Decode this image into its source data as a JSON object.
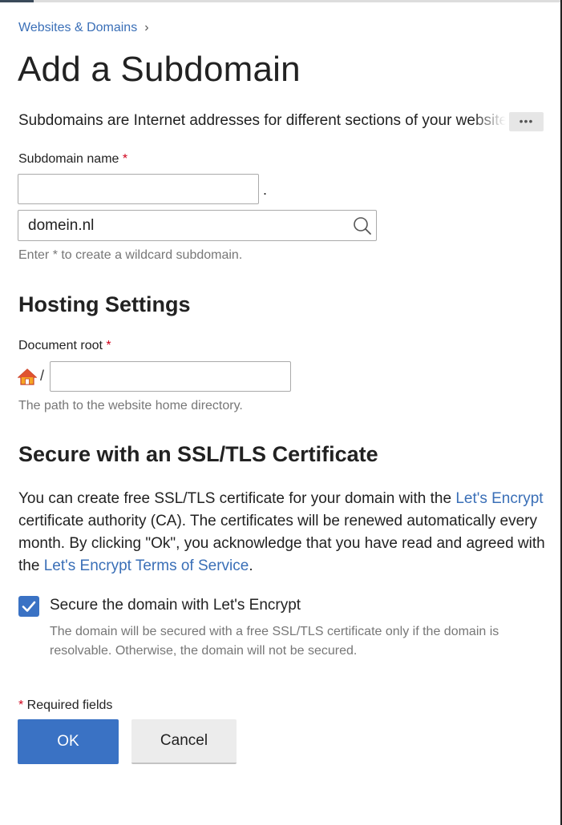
{
  "breadcrumb": {
    "link": "Websites & Domains",
    "chevron": "›"
  },
  "page_title": "Add a Subdomain",
  "description": "Subdomains are Internet addresses for different sections of your website.",
  "more_button": "•••",
  "subdomain": {
    "label": "Subdomain name",
    "required_mark": "*",
    "value": "",
    "separator": ".",
    "domain_value": "domein.nl",
    "hint": "Enter * to create a wildcard subdomain."
  },
  "hosting": {
    "heading": "Hosting Settings",
    "doc_root_label": "Document root",
    "required_mark": "*",
    "path_prefix": "/",
    "value": "",
    "hint": "The path to the website home directory."
  },
  "ssl": {
    "heading": "Secure with an SSL/TLS Certificate",
    "para_1": "You can create free SSL/TLS certificate for your domain with the ",
    "link_1": "Let's Encrypt",
    "para_2": " certificate authority (CA). The certificates will be renewed automatically every month. By clicking \"Ok\", you acknowledge that you have read and agreed with the ",
    "link_2": "Let's Encrypt Terms of Service",
    "para_3": ".",
    "checkbox_label": "Secure the domain with Let's Encrypt",
    "checkbox_checked": true,
    "checkbox_desc": "The domain will be secured with a free SSL/TLS certificate only if the domain is resolvable. Otherwise, the domain will not be secured."
  },
  "footer": {
    "required_mark": "*",
    "required_note": " Required fields",
    "ok_label": "OK",
    "cancel_label": "Cancel"
  },
  "colors": {
    "accent": "#3a72c4",
    "link": "#3a6fb7",
    "required": "#d0021b"
  },
  "icons": {
    "search": "search-icon",
    "home": "home-icon",
    "check": "checkmark-icon",
    "breadcrumb": "chevron-right-icon"
  }
}
